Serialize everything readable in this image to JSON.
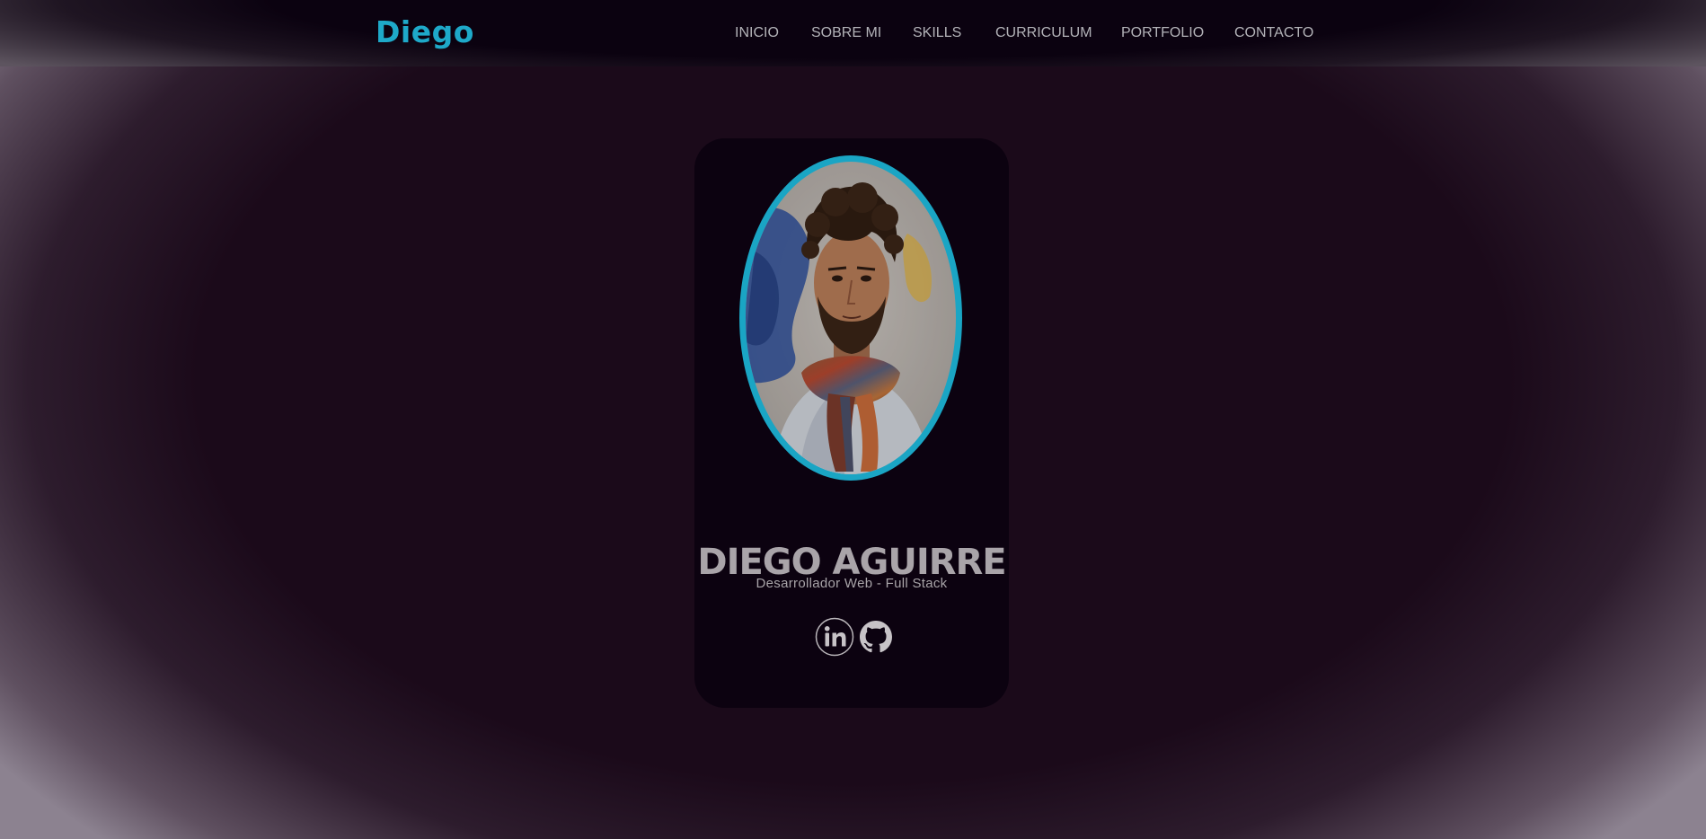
{
  "header": {
    "brand": "Diego",
    "nav": [
      {
        "label": "INICIO"
      },
      {
        "label": "SOBRE MI"
      },
      {
        "label": "SKILLS"
      },
      {
        "label": "CURRICULUM"
      },
      {
        "label": "PORTFOLIO"
      },
      {
        "label": "CONTACTO"
      }
    ]
  },
  "profile": {
    "name": "DIEGO AGUIRRE",
    "role": "Desarrollador Web - Full Stack",
    "photo_icon": "watercolor-portrait",
    "socials": [
      {
        "icon": "linkedin-icon"
      },
      {
        "icon": "github-icon"
      }
    ]
  },
  "colors": {
    "accent": "#1ea9c9",
    "background": "#1b0a1a",
    "card": "#0c0210",
    "text": "#b3b3b8"
  }
}
